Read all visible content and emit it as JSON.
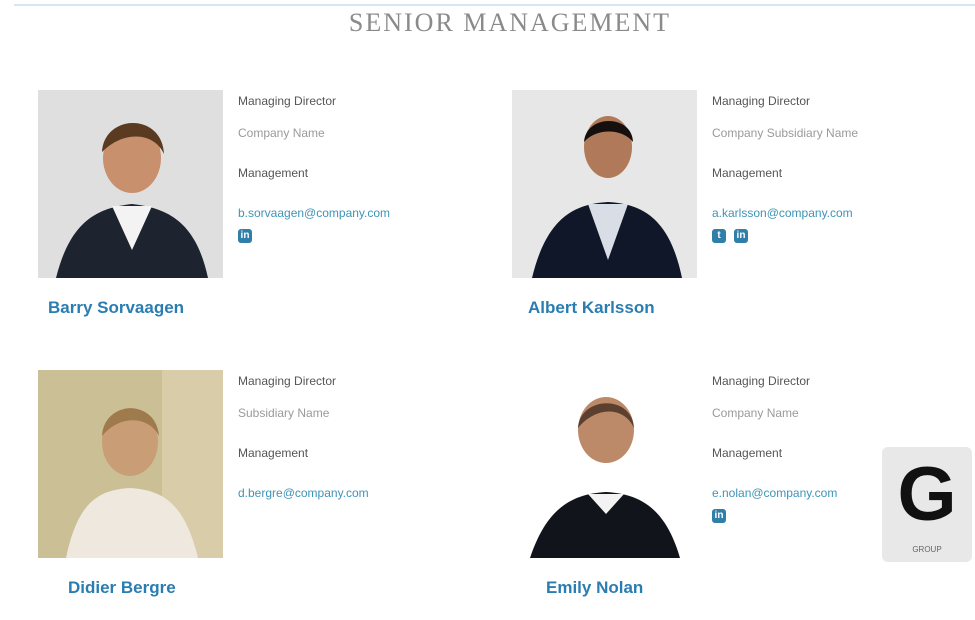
{
  "page": {
    "title": "SENIOR MANAGEMENT"
  },
  "people": [
    {
      "name": "Barry Sorvaagen",
      "role": "Managing Director",
      "company": "Company Name",
      "department": "Management",
      "email": "b.sorvaagen@company.com",
      "socials": [
        "linkedin"
      ]
    },
    {
      "name": "Albert Karlsson",
      "role": "Managing Director",
      "company": "Company Subsidiary Name",
      "department": "Management",
      "email": "a.karlsson@company.com",
      "socials": [
        "twitter",
        "linkedin"
      ]
    },
    {
      "name": "Didier Bergre",
      "role": "Managing Director",
      "company": "Subsidiary Name",
      "department": "Management",
      "email": "d.bergre@company.com",
      "socials": []
    },
    {
      "name": "Emily Nolan",
      "role": "Managing Director",
      "company": "Company Name",
      "department": "Management",
      "email": "e.nolan@company.com",
      "socials": [
        "linkedin"
      ]
    }
  ],
  "badge": {
    "icon": "logo-icon",
    "glyph": "G",
    "caption": "GROUP"
  },
  "colors": {
    "name": "#2a7db1",
    "email": "#3e94b8",
    "social": "#2f7fa8"
  }
}
